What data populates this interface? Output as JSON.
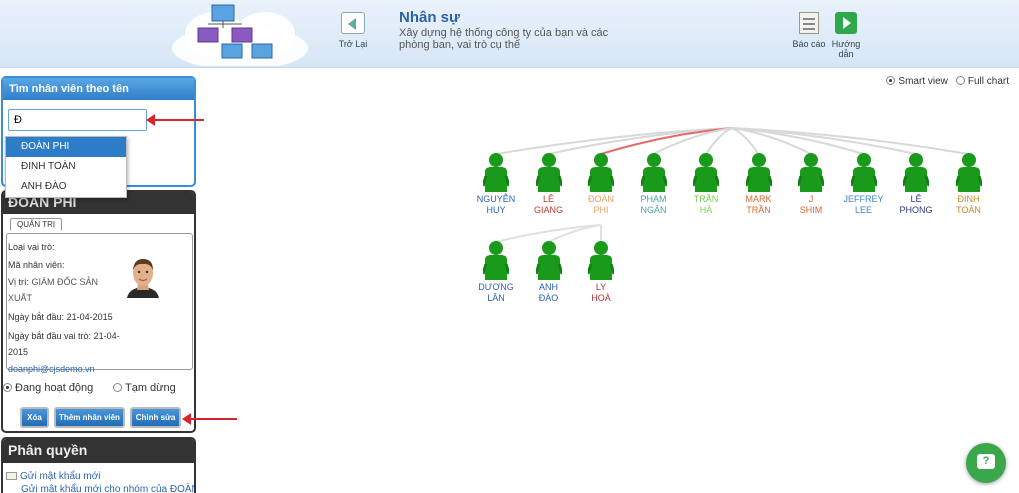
{
  "header": {
    "back_label": "Trở Lại",
    "title": "Nhân sự",
    "subtitle": "Xây dựng hệ thống công ty của bạn và các phòng ban, vai trò cụ thể",
    "report_label": "Báo cáo",
    "guide_label": "Hướng dẫn"
  },
  "view": {
    "smart_label": "Smart view",
    "full_label": "Full chart",
    "selected": "smart"
  },
  "search": {
    "title": "Tìm nhân viên theo tên",
    "value": "Đ",
    "suggestions": [
      "ĐOÀN PHI",
      "ĐINH TOÀN",
      "ANH ĐÀO"
    ]
  },
  "profile": {
    "name": "ĐOÀN PHI",
    "tab": "QUẢN TRỊ",
    "role_type_label": "Loại vai trò:",
    "employee_code_label": "Mã nhân viên:",
    "position_label": "Vị trí:",
    "position_value": "GIÁM ĐỐC SẢN XUẤT",
    "start_label": "Ngày bắt đầu:",
    "start_value": "21-04-2015",
    "role_start_label": "Ngày bắt đầu vai trò:",
    "role_start_value": "21-04-2015",
    "email": "doanphi@cjsdemo.vn",
    "status_active": "Đang hoạt động",
    "status_paused": "Tạm dừng",
    "delete_btn": "Xóa",
    "add_btn": "Thêm nhân viên",
    "edit_btn": "Chỉnh sửa"
  },
  "permission": {
    "title": "Phân quyền",
    "item1": "Gửi mật khẩu mới",
    "item2": "Gửi mật khẩu mới cho nhóm của ĐOÀN"
  },
  "colors": {
    "accent": "#2f7fc7",
    "node_green": "#1a9a1a",
    "arrow": "#d6262b"
  },
  "org": {
    "top": [
      {
        "l1": "NGUYỄN",
        "l2": "HUY",
        "color": "#2c5fb8"
      },
      {
        "l1": "LÊ",
        "l2": "GIANG",
        "color": "#c0392b"
      },
      {
        "l1": "ĐOÀN",
        "l2": "PHI",
        "color": "#e8a35a"
      },
      {
        "l1": "PHẠM",
        "l2": "NGÂN",
        "color": "#4aa3a3"
      },
      {
        "l1": "TRẦN",
        "l2": "HÀ",
        "color": "#77d04a"
      },
      {
        "l1": "MARK",
        "l2": "TRẦN",
        "color": "#d86a2a"
      },
      {
        "l1": "J",
        "l2": "SHIM",
        "color": "#d9622b"
      },
      {
        "l1": "JEFFREY",
        "l2": "LEE",
        "color": "#3f86c8"
      },
      {
        "l1": "LÊ",
        "l2": "PHONG",
        "color": "#2a3a8a"
      },
      {
        "l1": "ĐINH",
        "l2": "TOÀN",
        "color": "#c98a2a"
      }
    ],
    "sub": [
      {
        "l1": "DƯƠNG",
        "l2": "LÂN",
        "color": "#2c5fb8"
      },
      {
        "l1": "ANH",
        "l2": "ĐÀO",
        "color": "#2c5fb8"
      },
      {
        "l1": "LY",
        "l2": "HOÀ",
        "color": "#b03030"
      }
    ]
  }
}
